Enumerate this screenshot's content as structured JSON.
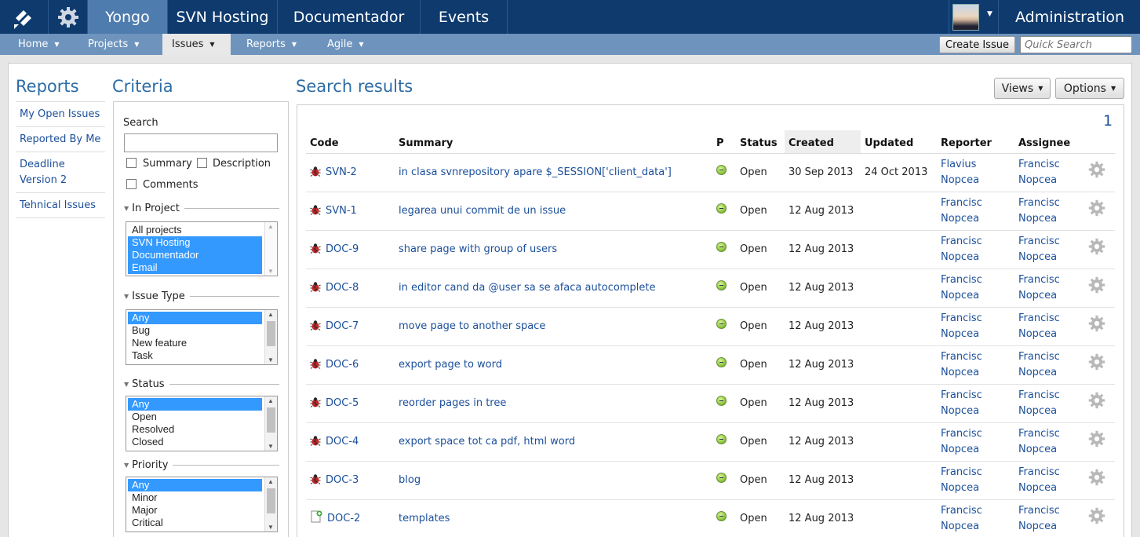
{
  "topbar": {
    "tabs": [
      "Yongo",
      "SVN Hosting",
      "Documentador",
      "Events"
    ],
    "admin_label": "Administration"
  },
  "subnav": {
    "items": [
      "Home",
      "Projects",
      "Issues",
      "Reports",
      "Agile"
    ],
    "create_issue_label": "Create Issue",
    "quick_search_placeholder": "Quick Search"
  },
  "reports": {
    "title": "Reports",
    "items": [
      "My Open Issues",
      "Reported By Me",
      "Deadline Version 2",
      "Tehnical Issues"
    ]
  },
  "criteria": {
    "title": "Criteria",
    "search_label": "Search",
    "summary_label": "Summary",
    "description_label": "Description",
    "comments_label": "Comments",
    "project_label": "In Project",
    "project_options": [
      "All projects",
      "SVN Hosting",
      "Documentador",
      "Email"
    ],
    "issue_type_label": "Issue Type",
    "issue_type_options": [
      "Any",
      "Bug",
      "New feature",
      "Task"
    ],
    "status_label": "Status",
    "status_options": [
      "Any",
      "Open",
      "Resolved",
      "Closed"
    ],
    "priority_label": "Priority",
    "priority_options": [
      "Any",
      "Minor",
      "Major",
      "Critical"
    ]
  },
  "results": {
    "title": "Search results",
    "views_label": "Views",
    "options_label": "Options",
    "page": "1",
    "columns": [
      "Code",
      "Summary",
      "P",
      "Status",
      "Created",
      "Updated",
      "Reporter",
      "Assignee"
    ],
    "rows": [
      {
        "code": "SVN-2",
        "type": "bug",
        "summary": "in clasa svnrepository apare $_SESSION['client_data']",
        "status": "Open",
        "created": "30 Sep 2013",
        "updated": "24 Oct 2013",
        "reporter": [
          "Flavius",
          "Nopcea"
        ],
        "assignee": [
          "Francisc",
          "Nopcea"
        ]
      },
      {
        "code": "SVN-1",
        "type": "bug",
        "summary": "legarea unui commit de un issue",
        "status": "Open",
        "created": "12 Aug 2013",
        "updated": "",
        "reporter": [
          "Francisc",
          "Nopcea"
        ],
        "assignee": [
          "Francisc",
          "Nopcea"
        ]
      },
      {
        "code": "DOC-9",
        "type": "bug",
        "summary": "share page with group of users",
        "status": "Open",
        "created": "12 Aug 2013",
        "updated": "",
        "reporter": [
          "Francisc",
          "Nopcea"
        ],
        "assignee": [
          "Francisc",
          "Nopcea"
        ]
      },
      {
        "code": "DOC-8",
        "type": "bug",
        "summary": "in editor cand da @user sa se afaca autocomplete",
        "status": "Open",
        "created": "12 Aug 2013",
        "updated": "",
        "reporter": [
          "Francisc",
          "Nopcea"
        ],
        "assignee": [
          "Francisc",
          "Nopcea"
        ]
      },
      {
        "code": "DOC-7",
        "type": "bug",
        "summary": "move page to another space",
        "status": "Open",
        "created": "12 Aug 2013",
        "updated": "",
        "reporter": [
          "Francisc",
          "Nopcea"
        ],
        "assignee": [
          "Francisc",
          "Nopcea"
        ]
      },
      {
        "code": "DOC-6",
        "type": "bug",
        "summary": "export page to word",
        "status": "Open",
        "created": "12 Aug 2013",
        "updated": "",
        "reporter": [
          "Francisc",
          "Nopcea"
        ],
        "assignee": [
          "Francisc",
          "Nopcea"
        ]
      },
      {
        "code": "DOC-5",
        "type": "bug",
        "summary": "reorder pages in tree",
        "status": "Open",
        "created": "12 Aug 2013",
        "updated": "",
        "reporter": [
          "Francisc",
          "Nopcea"
        ],
        "assignee": [
          "Francisc",
          "Nopcea"
        ]
      },
      {
        "code": "DOC-4",
        "type": "bug",
        "summary": "export space tot ca pdf, html word",
        "status": "Open",
        "created": "12 Aug 2013",
        "updated": "",
        "reporter": [
          "Francisc",
          "Nopcea"
        ],
        "assignee": [
          "Francisc",
          "Nopcea"
        ]
      },
      {
        "code": "DOC-3",
        "type": "bug",
        "summary": "blog",
        "status": "Open",
        "created": "12 Aug 2013",
        "updated": "",
        "reporter": [
          "Francisc",
          "Nopcea"
        ],
        "assignee": [
          "Francisc",
          "Nopcea"
        ]
      },
      {
        "code": "DOC-2",
        "type": "new-feature",
        "summary": "templates",
        "status": "Open",
        "created": "12 Aug 2013",
        "updated": "",
        "reporter": [
          "Francisc",
          "Nopcea"
        ],
        "assignee": [
          "Francisc",
          "Nopcea"
        ]
      }
    ]
  }
}
